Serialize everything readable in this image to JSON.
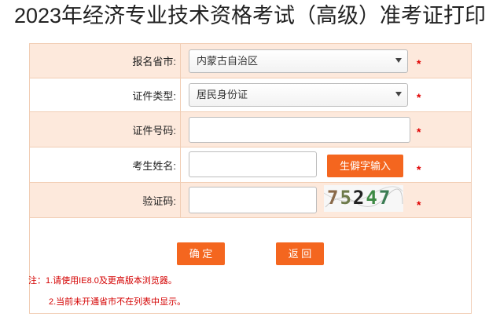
{
  "page": {
    "title": "2023年经济专业技术资格考试（高级）准考证打印"
  },
  "form": {
    "province": {
      "label": "报名省市:",
      "selected": "内蒙古自治区",
      "required_mark": "*"
    },
    "id_type": {
      "label": "证件类型:",
      "selected": "居民身份证",
      "required_mark": "*"
    },
    "id_number": {
      "label": "证件号码:",
      "value": "",
      "required_mark": "*"
    },
    "name": {
      "label": "考生姓名:",
      "value": "",
      "rare_char_button": "生僻字输入",
      "required_mark": "*"
    },
    "captcha": {
      "label": "验证码:",
      "value": "",
      "image_text": "75247",
      "required_mark": "*"
    }
  },
  "actions": {
    "confirm": "确 定",
    "back": "返 回"
  },
  "notes": {
    "line1": "注：1.请使用IE8.0及更高版本浏览器。",
    "line2": "2.当前未开通省市不在列表中显示。"
  },
  "colors": {
    "accent": "#f4661f",
    "row_alt_bg": "#fde9dc",
    "border": "#f1cdb4",
    "required": "#e00000",
    "note_text": "#d40000"
  }
}
